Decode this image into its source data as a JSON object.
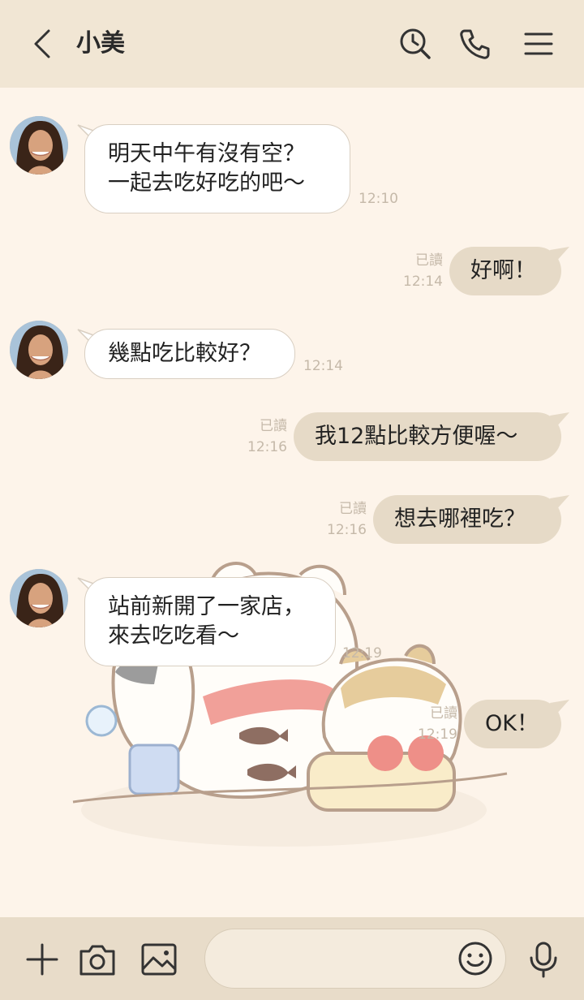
{
  "header": {
    "title": "小美"
  },
  "messages": [
    {
      "side": "in",
      "text": "明天中午有沒有空？\n一起去吃好吃的吧～",
      "time": "12:10"
    },
    {
      "side": "out",
      "text": "好啊！",
      "read": "已讀",
      "time": "12:14"
    },
    {
      "side": "in",
      "text": "幾點吃比較好？",
      "time": "12:14"
    },
    {
      "side": "out",
      "text": "我12點比較方便喔～",
      "read": "已讀",
      "time": "12:16"
    },
    {
      "side": "out",
      "text": "想去哪裡吃？",
      "read": "已讀",
      "time": "12:16"
    },
    {
      "side": "in",
      "text": "站前新開了一家店，\n來去吃吃看～",
      "time": "12:19"
    },
    {
      "side": "out",
      "text": "OK！",
      "read": "已讀",
      "time": "12:19"
    }
  ],
  "icons": {
    "back": "chevron-left-icon",
    "search": "search-clock-icon",
    "call": "phone-icon",
    "menu": "hamburger-menu-icon",
    "add": "plus-icon",
    "camera": "camera-icon",
    "image": "image-icon",
    "emoji": "smiley-icon",
    "mic": "microphone-icon"
  },
  "colors": {
    "header_bg": "#f1e6d4",
    "chat_bg": "#fdf4ea",
    "out_bubble": "#e6dac7",
    "footer_bg": "#e8dcc9"
  }
}
